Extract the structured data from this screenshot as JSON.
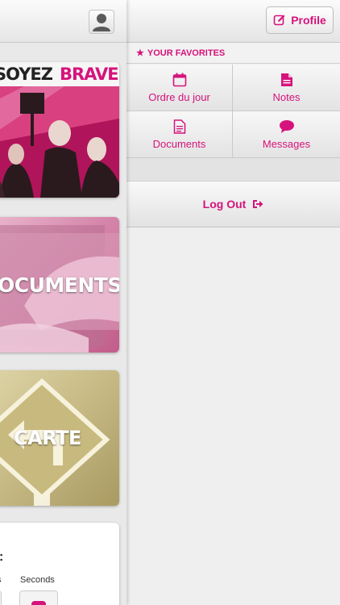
{
  "profile": {
    "label": "Profile"
  },
  "favorites": {
    "header": "YOUR FAVORITES",
    "items": [
      {
        "label": "Ordre du jour",
        "icon": "calendar-icon"
      },
      {
        "label": "Notes",
        "icon": "note-icon"
      },
      {
        "label": "Documents",
        "icon": "document-icon"
      },
      {
        "label": "Messages",
        "icon": "chat-icon"
      }
    ]
  },
  "logout": {
    "label": "Log Out",
    "icon": "signout-icon"
  },
  "left_panel": {
    "cards": [
      {
        "label_soyez": "SOYEZ",
        "label_brave": "BRAVE"
      },
      {
        "label": "OCUMENTS"
      },
      {
        "label": "CARTE"
      }
    ],
    "timer": {
      "label_partial": "s",
      "seconds_label": "Seconds",
      "colon": ":"
    }
  },
  "colors": {
    "accent": "#d6137c",
    "brand_banner": "#a10f4f"
  }
}
